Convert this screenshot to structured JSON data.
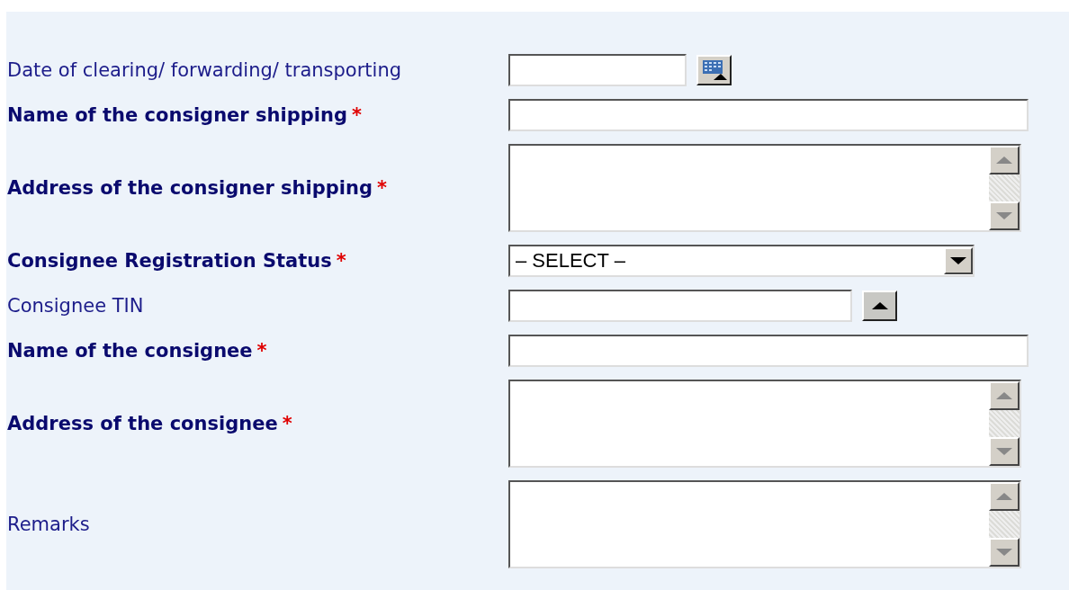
{
  "form": {
    "rows": [
      {
        "label": "Date of clearing/ forwarding/ transporting",
        "required": false,
        "field": {
          "kind": "date"
        }
      },
      {
        "label": "Name of the consigner shipping",
        "required": true,
        "required_mark": "*",
        "field": {
          "kind": "text"
        }
      },
      {
        "label": "Address of the consigner shipping",
        "required": true,
        "required_mark": "*",
        "field": {
          "kind": "textarea"
        }
      },
      {
        "label": "Consignee Registration Status",
        "required": true,
        "required_mark": "*",
        "field": {
          "kind": "select",
          "value": "– SELECT –"
        }
      },
      {
        "label": "Consignee TIN",
        "required": false,
        "field": {
          "kind": "tin"
        }
      },
      {
        "label": "Name of the consignee",
        "required": true,
        "required_mark": "*",
        "field": {
          "kind": "text"
        }
      },
      {
        "label": "Address of the consignee",
        "required": true,
        "required_mark": "*",
        "field": {
          "kind": "textarea"
        }
      },
      {
        "label": "Remarks",
        "required": false,
        "field": {
          "kind": "textarea"
        }
      }
    ]
  }
}
